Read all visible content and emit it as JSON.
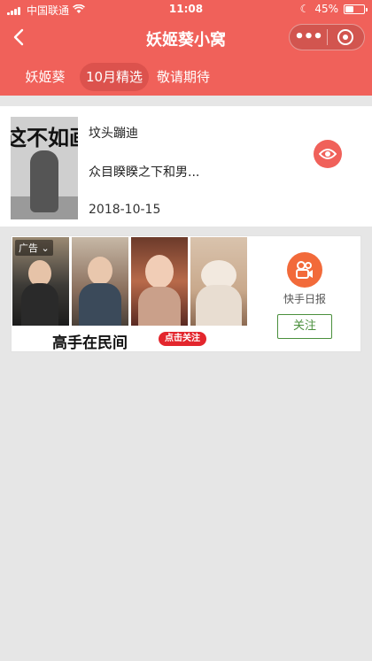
{
  "status": {
    "carrier": "中国联通",
    "time": "11:08",
    "battery": "45%",
    "battery_level": 0.45
  },
  "navbar": {
    "title": "妖姬葵小窝"
  },
  "tabs": [
    {
      "label": "妖姬葵",
      "active": false
    },
    {
      "label": "10月精选",
      "active": true
    },
    {
      "label": "敬请期待",
      "active": false
    }
  ],
  "article": {
    "thumb_text": "这不如画",
    "name": "坟头蹦迪",
    "desc": "众目睽睽之下和男...",
    "date": "2018-10-15"
  },
  "ad": {
    "badge": "广告",
    "slogan": "高手在民间",
    "cta": "点击关注",
    "brand": "快手日报",
    "follow": "关注"
  },
  "colors": {
    "primary": "#f0615a",
    "follow": "#4a8f3c",
    "background": "#e6e6e6"
  },
  "icons": [
    "back-arrow-icon",
    "more-dots-icon",
    "target-icon",
    "eye-icon",
    "kuaishou-camera-icon",
    "wifi-icon",
    "signal-icon",
    "battery-icon"
  ]
}
